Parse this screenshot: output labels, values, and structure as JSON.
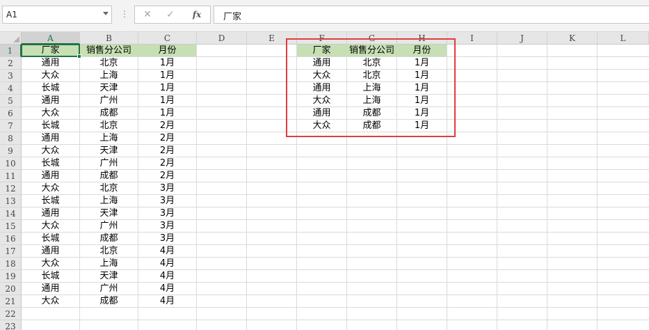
{
  "formula_bar": {
    "name_box": "A1",
    "separator": "⋮",
    "cancel_icon": "✕",
    "enter_icon": "✓",
    "function_icon": "fx",
    "formula_value": "厂家"
  },
  "grid": {
    "columns": [
      "A",
      "B",
      "C",
      "D",
      "E",
      "F",
      "G",
      "H",
      "I",
      "J",
      "K",
      "L"
    ],
    "rows": [
      "1",
      "2",
      "3",
      "4",
      "5",
      "6",
      "7",
      "8",
      "9",
      "10",
      "11",
      "12",
      "13",
      "14",
      "15",
      "16",
      "17",
      "18",
      "19",
      "20",
      "21",
      "22",
      "23"
    ],
    "active_cell": "A1"
  },
  "source_table": {
    "headers": [
      "厂家",
      "销售分公司",
      "月份"
    ],
    "rows": [
      [
        "通用",
        "北京",
        "1月"
      ],
      [
        "大众",
        "上海",
        "1月"
      ],
      [
        "长城",
        "天津",
        "1月"
      ],
      [
        "通用",
        "广州",
        "1月"
      ],
      [
        "大众",
        "成都",
        "1月"
      ],
      [
        "长城",
        "北京",
        "2月"
      ],
      [
        "通用",
        "上海",
        "2月"
      ],
      [
        "大众",
        "天津",
        "2月"
      ],
      [
        "长城",
        "广州",
        "2月"
      ],
      [
        "通用",
        "成都",
        "2月"
      ],
      [
        "大众",
        "北京",
        "3月"
      ],
      [
        "长城",
        "上海",
        "3月"
      ],
      [
        "通用",
        "天津",
        "3月"
      ],
      [
        "大众",
        "广州",
        "3月"
      ],
      [
        "长城",
        "成都",
        "3月"
      ],
      [
        "通用",
        "北京",
        "4月"
      ],
      [
        "大众",
        "上海",
        "4月"
      ],
      [
        "长城",
        "天津",
        "4月"
      ],
      [
        "通用",
        "广州",
        "4月"
      ],
      [
        "大众",
        "成都",
        "4月"
      ]
    ]
  },
  "result_table": {
    "headers": [
      "厂家",
      "销售分公司",
      "月份"
    ],
    "rows": [
      [
        "通用",
        "北京",
        "1月"
      ],
      [
        "大众",
        "北京",
        "1月"
      ],
      [
        "通用",
        "上海",
        "1月"
      ],
      [
        "大众",
        "上海",
        "1月"
      ],
      [
        "通用",
        "成都",
        "1月"
      ],
      [
        "大众",
        "成都",
        "1月"
      ]
    ]
  },
  "colors": {
    "header_fill": "#c6e0b4",
    "selection": "#217346",
    "highlight_border": "#e03c3c"
  }
}
